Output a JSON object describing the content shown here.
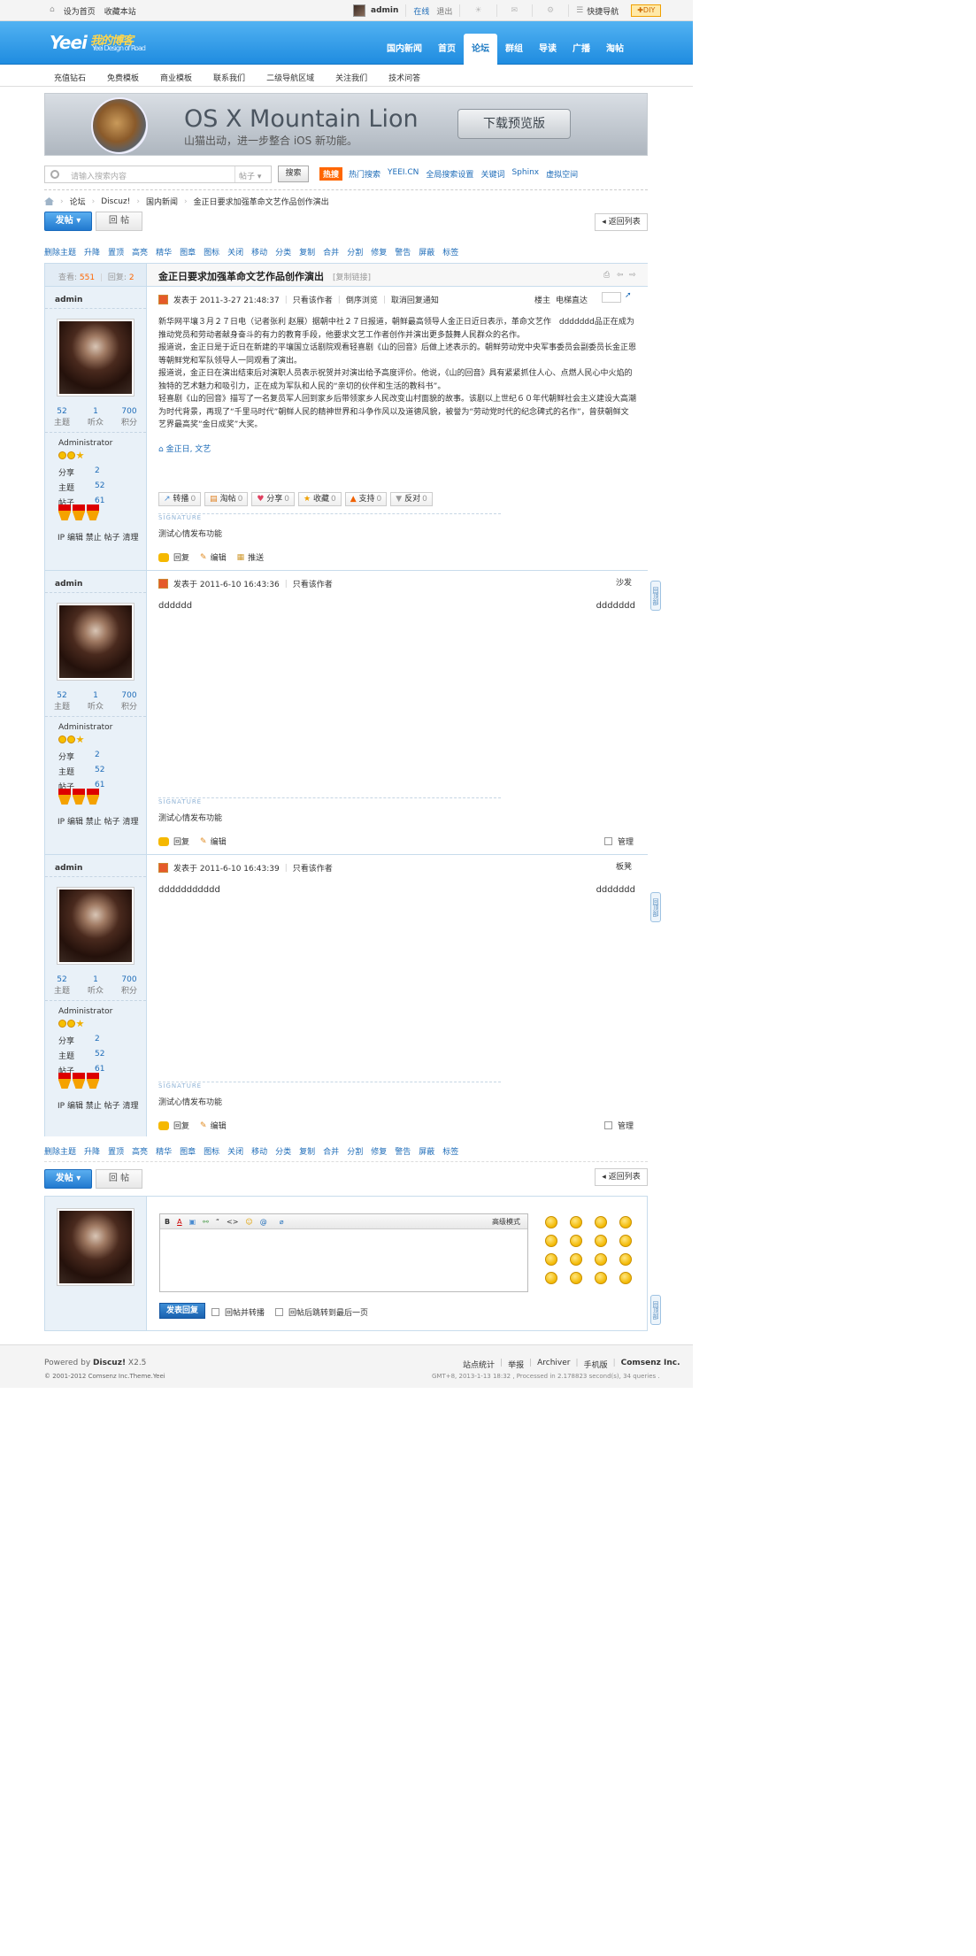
{
  "topbar": {
    "links": [
      "设为首页",
      "收藏本站"
    ],
    "username": "admin",
    "status": "在线",
    "logout": "退出",
    "quicknav": "快捷导航",
    "diy": "DIY"
  },
  "logo": {
    "text": "Yeei",
    "cn": "我的博客",
    "sub": "Yeei Design of Road"
  },
  "mainnav": [
    "国内新闻",
    "首页",
    "论坛",
    "群组",
    "导读",
    "广播",
    "淘帖"
  ],
  "mainnav_active": "论坛",
  "subnav": [
    "充值钻石",
    "免费模板",
    "商业模板",
    "联系我们",
    "二级导航区域",
    "关注我们",
    "技术问答"
  ],
  "banner": {
    "title": "OS X Mountain Lion",
    "subtitle": "山猫出动，进一步整合 iOS 新功能。",
    "button": "下载预览版"
  },
  "search": {
    "placeholder": "请输入搜索内容",
    "type": "帖子",
    "button": "搜索",
    "hot_label": "热搜",
    "hot_links": [
      "热门搜索",
      "YEEI.CN",
      "全局搜索设置",
      "关键词",
      "Sphinx",
      "虚拟空间"
    ]
  },
  "breadcrumb": [
    "论坛",
    "Discuz!",
    "国内新闻",
    "金正日要求加强革命文艺作品创作演出"
  ],
  "buttons": {
    "post": "发帖",
    "reply": "回 帖",
    "back": "返回列表"
  },
  "modbar": [
    "删除主题",
    "升降",
    "置顶",
    "高亮",
    "精华",
    "图章",
    "图标",
    "关闭",
    "移动",
    "分类",
    "复制",
    "合并",
    "分割",
    "修复",
    "警告",
    "屏蔽",
    "标签"
  ],
  "thread": {
    "views_label": "查看:",
    "views": "551",
    "replies_label": "回复:",
    "replies": "2",
    "title": "金正日要求加强革命文艺作品创作演出",
    "copy_link": "[复制链接]"
  },
  "user": {
    "name": "admin",
    "stats": [
      {
        "n": "52",
        "l": "主题"
      },
      {
        "n": "1",
        "l": "听众"
      },
      {
        "n": "700",
        "l": "积分"
      }
    ],
    "group": "Administrator",
    "kv": [
      {
        "k": "分享",
        "v": "2"
      },
      {
        "k": "主题",
        "v": "52"
      },
      {
        "k": "帖子",
        "v": "61"
      }
    ],
    "ops": "IP 编辑 禁止 帖子 清理"
  },
  "posts": [
    {
      "time": "发表于 2011-3-27 21:48:37",
      "only_author": "只看该作者",
      "reverse": "倒序浏览",
      "cancel_notify": "取消回复通知",
      "floor": "楼主",
      "elevator": "电梯直达",
      "body": [
        "新华网平壤３月２７日电（记者张利 赵展）据朝中社２７日报道，朝鲜最高领导人金正日近日表示，革命文艺作　ddddddd品正在成为推动党员和劳动者献身奋斗的有力的教育手段，他要求文艺工作者创作并演出更多鼓舞人民群众的名作。",
        "报道说，金正日是于近日在新建的平壤国立话剧院观看轻喜剧《山的回音》后做上述表示的。朝鲜劳动党中央军事委员会副委员长金正恩等朝鲜党和军队领导人一同观看了演出。",
        "报道说，金正日在演出结束后对演职人员表示祝贺并对演出给予高度评价。他说，《山的回音》具有紧紧抓住人心、点燃人民心中火焰的独特的艺术魅力和吸引力，正在成为军队和人民的“亲切的伙伴和生活的教科书”。",
        "轻喜剧《山的回音》描写了一名复员军人回到家乡后带领家乡人民改变山村面貌的故事。该剧以上世纪６０年代朝鲜社会主义建设大高潮为时代背景，再现了“千里马时代”朝鲜人民的精神世界和斗争作风以及道德风貌，被誉为“劳动党时代的纪念碑式的名作”，曾获朝鲜文艺界最高奖“金日成奖”大奖。"
      ],
      "tags": "金正日, 文艺",
      "share_btns": [
        {
          "l": "转播",
          "c": "0"
        },
        {
          "l": "淘帖",
          "c": "0"
        },
        {
          "l": "分享",
          "c": "0"
        },
        {
          "l": "收藏",
          "c": "0"
        },
        {
          "l": "支持",
          "c": "0"
        },
        {
          "l": "反对",
          "c": "0"
        }
      ],
      "sig_label": "SIGNATURE",
      "sig": "测试心情发布功能",
      "actions": [
        "回复",
        "编辑",
        "推送"
      ]
    },
    {
      "time": "发表于 2011-6-10 16:43:36",
      "only_author": "只看该作者",
      "floor": "沙发",
      "body": "dddddd",
      "right_text": "ddddddd",
      "sig_label": "SIGNATURE",
      "sig": "测试心情发布功能",
      "actions": [
        "回复",
        "编辑"
      ],
      "manage": "管理"
    },
    {
      "time": "发表于 2011-6-10 16:43:39",
      "only_author": "只看该作者",
      "floor": "板凳",
      "body": "ddddddddddd",
      "right_text": "ddddddd",
      "sig_label": "SIGNATURE",
      "sig": "测试心情发布功能",
      "actions": [
        "回复",
        "编辑"
      ],
      "manage": "管理"
    }
  ],
  "totop": "回顶部",
  "editor": {
    "toolbar": [
      "B",
      "A",
      "▣",
      "⚯",
      "“",
      "<>",
      "☺",
      "@",
      "⌀"
    ],
    "advanced": "高级模式",
    "submit": "发表回复",
    "opt1": "回帖并转播",
    "opt2": "回帖后跳转到最后一页"
  },
  "footer": {
    "powered": "Powered by",
    "brand": "Discuz!",
    "version": "X2.5",
    "copyright": "© 2001-2012 Comsenz Inc.Theme.Yeei",
    "links": [
      "站点统计",
      "举报",
      "Archiver",
      "手机版",
      "Comsenz Inc."
    ],
    "info": "GMT+8, 2013-1-13 18:32 , Processed in 2.178823 second(s), 34 queries ."
  }
}
